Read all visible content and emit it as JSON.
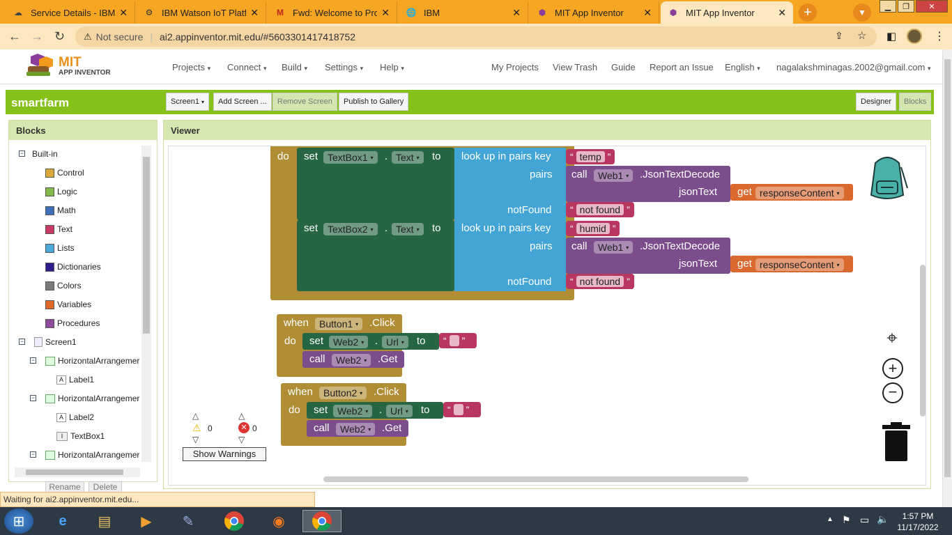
{
  "browser": {
    "tabs": [
      {
        "title": "Service Details - IBM Cl",
        "icon": "ibm-cloud-icon"
      },
      {
        "title": "IBM Watson IoT Platfor",
        "icon": "watson-iot-icon"
      },
      {
        "title": "Fwd: Welcome to Proje",
        "icon": "gmail-icon"
      },
      {
        "title": "IBM",
        "icon": "globe-icon"
      },
      {
        "title": "MIT App Inventor",
        "icon": "app-inventor-icon"
      },
      {
        "title": "MIT App Inventor",
        "icon": "app-inventor-icon"
      }
    ],
    "security": "Not secure",
    "url": "ai2.appinventor.mit.edu/#5603301417418752"
  },
  "app": {
    "logo_line1": "MIT",
    "logo_line2": "APP INVENTOR",
    "menu": [
      "Projects",
      "Connect",
      "Build",
      "Settings",
      "Help"
    ],
    "right_links": [
      "My Projects",
      "View Trash",
      "Guide",
      "Report an Issue",
      "English"
    ],
    "user": "nagalakshminagas.2002@gmail.com"
  },
  "project": {
    "name": "smartfarm",
    "screen": "Screen1",
    "add_screen": "Add Screen ...",
    "remove_screen": "Remove Screen",
    "publish": "Publish to Gallery",
    "designer": "Designer",
    "blocks": "Blocks"
  },
  "blocks_panel": {
    "title": "Blocks",
    "builtin": "Built-in",
    "categories": [
      {
        "label": "Control",
        "color": "#d9a93c"
      },
      {
        "label": "Logic",
        "color": "#83b84a"
      },
      {
        "label": "Math",
        "color": "#3f6fb8"
      },
      {
        "label": "Text",
        "color": "#c83a64"
      },
      {
        "label": "Lists",
        "color": "#4aa8d8"
      },
      {
        "label": "Dictionaries",
        "color": "#2d1d8c"
      },
      {
        "label": "Colors",
        "color": "#7a7a7a"
      },
      {
        "label": "Variables",
        "color": "#e0662a"
      },
      {
        "label": "Procedures",
        "color": "#8b4c9c"
      }
    ],
    "components": [
      "Screen1",
      "HorizontalArrangemer",
      "Label1",
      "HorizontalArrangemer",
      "Label2",
      "TextBox1",
      "HorizontalArrangemer"
    ],
    "rename": "Rename",
    "delete": "Delete"
  },
  "viewer": {
    "title": "Viewer",
    "kw": {
      "do": "do",
      "set": "set",
      "to": "to",
      "dot": ".",
      "when": "when",
      "call": "call",
      "lookup": "look up in pairs  key",
      "pairs": "pairs",
      "notfound": "notFound",
      "jsontext": "jsonText",
      "get": "get"
    },
    "upper": [
      {
        "target": "TextBox1",
        "prop": "Text",
        "key": "temp",
        "web": "Web1",
        "method": ".JsonTextDecode",
        "var": "responseContent",
        "notfound": "not found"
      },
      {
        "target": "TextBox2",
        "prop": "Text",
        "key": "humid",
        "web": "Web1",
        "method": ".JsonTextDecode",
        "var": "responseContent",
        "notfound": "not found"
      }
    ],
    "events": [
      {
        "component": "Button1",
        "event": ".Click",
        "web": "Web2",
        "prop": "Url",
        "method": ".Get"
      },
      {
        "component": "Button2",
        "event": ".Click",
        "web": "Web2",
        "prop": "Url",
        "method": ".Get"
      }
    ],
    "warnings": {
      "warn_count": "0",
      "error_count": "0",
      "button": "Show Warnings"
    }
  },
  "status_text": "Waiting for ai2.appinventor.mit.edu...",
  "clock": {
    "time": "1:57 PM",
    "date": "11/17/2022"
  }
}
